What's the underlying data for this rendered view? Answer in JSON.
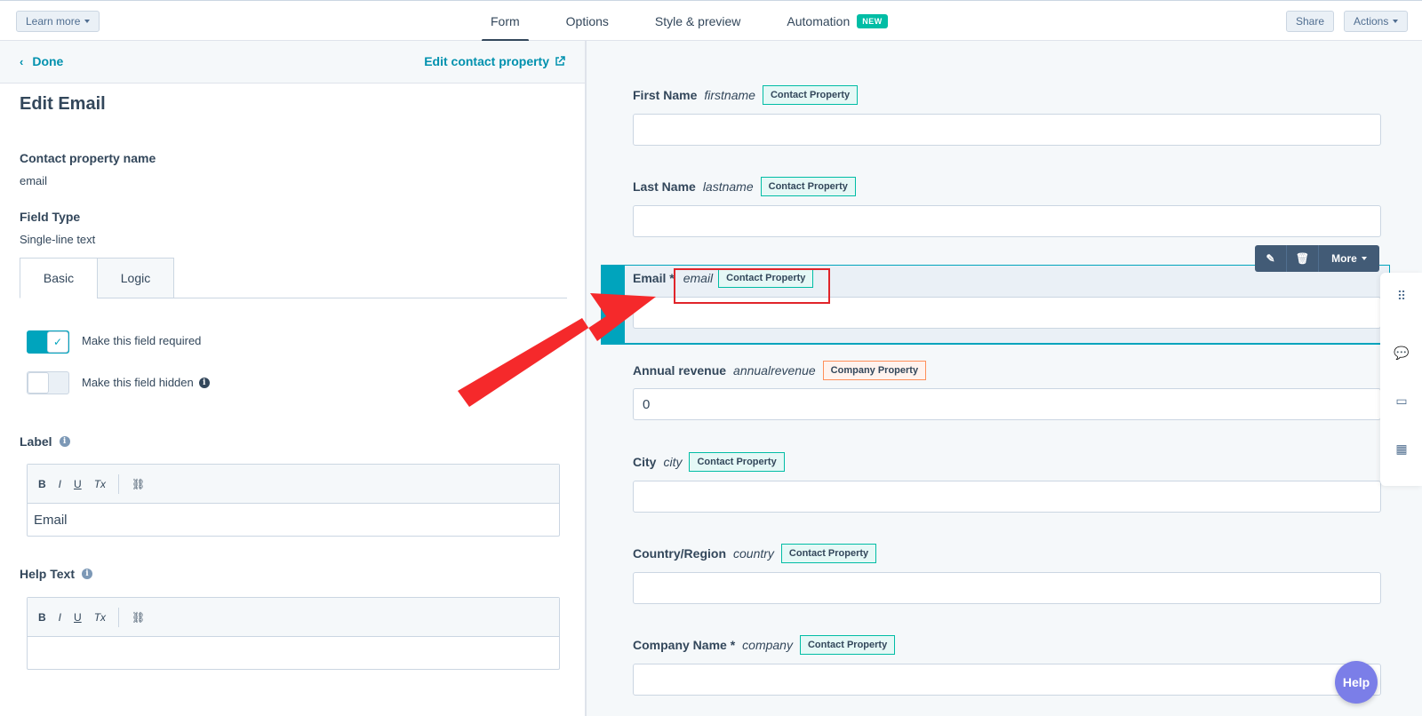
{
  "topbar": {
    "learn_more": "Learn more",
    "tabs": [
      "Form",
      "Options",
      "Style & preview",
      "Automation"
    ],
    "new_badge": "NEW",
    "share": "Share",
    "actions": "Actions"
  },
  "left": {
    "done": "Done",
    "edit_contact_property": "Edit contact property",
    "title": "Edit Email",
    "property_name_label": "Contact property name",
    "property_name_value": "email",
    "field_type_label": "Field Type",
    "field_type_value": "Single-line text",
    "subtabs": [
      "Basic",
      "Logic"
    ],
    "required_label": "Make this field required",
    "hidden_label": "Make this field hidden",
    "label_heading": "Label",
    "label_value": "Email",
    "help_text_heading": "Help Text",
    "help_text_value": "",
    "toolbar": [
      "B",
      "I",
      "U",
      "Tx"
    ]
  },
  "preview": {
    "fields": [
      {
        "label": "First Name",
        "internal": "firstname",
        "tag": "Contact Property",
        "value": ""
      },
      {
        "label": "Last Name",
        "internal": "lastname",
        "tag": "Contact Property",
        "value": ""
      },
      {
        "label": "Email *",
        "internal": "email",
        "tag": "Contact Property",
        "value": ""
      },
      {
        "label": "Annual revenue",
        "internal": "annualrevenue",
        "tag": "Company Property",
        "value": "0"
      },
      {
        "label": "City",
        "internal": "city",
        "tag": "Contact Property",
        "value": ""
      },
      {
        "label": "Country/Region",
        "internal": "country",
        "tag": "Contact Property",
        "value": ""
      },
      {
        "label": "Company Name *",
        "internal": "company",
        "tag": "Contact Property",
        "value": ""
      }
    ],
    "more": "More"
  },
  "help": "Help",
  "colors": {
    "accent": "#00a4bd",
    "link": "#0091ae",
    "arrow": "#f5292b",
    "help": "#7b7ee8"
  }
}
